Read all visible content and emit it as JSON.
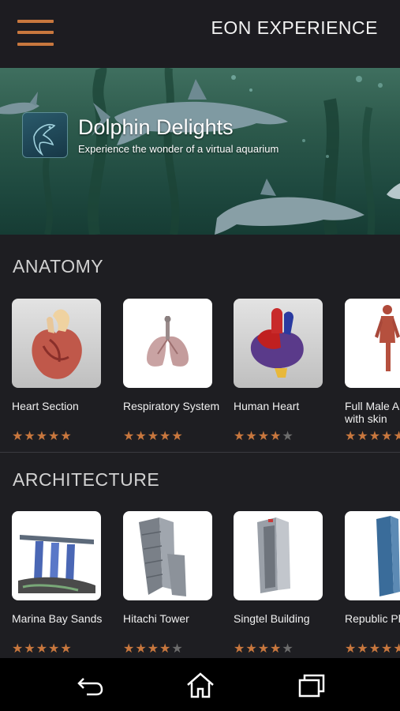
{
  "appbar": {
    "title": "EON EXPERIENCE",
    "menu_icon": "hamburger-menu-icon"
  },
  "banner": {
    "title": "Dolphin Delights",
    "subtitle": "Experience the wonder of a virtual aquarium",
    "thumb_icon": "dolphin-icon"
  },
  "colors": {
    "accent": "#c8773e",
    "background": "#1e1e22",
    "appbar": "#1d1c21",
    "star_off": "#6c6c6c"
  },
  "sections": [
    {
      "title": "ANATOMY",
      "items": [
        {
          "label": "Heart Section",
          "rating": 5,
          "thumb": "heart-section-model"
        },
        {
          "label": "Respiratory System",
          "rating": 5,
          "thumb": "lungs-model"
        },
        {
          "label": "Human Heart",
          "rating": 4,
          "thumb": "human-heart-model"
        },
        {
          "label": "Full Male Anatomy with skin",
          "rating": 5,
          "thumb": "male-anatomy-model"
        }
      ]
    },
    {
      "title": "ARCHITECTURE",
      "items": [
        {
          "label": "Marina Bay Sands",
          "rating": 5,
          "thumb": "marina-bay-sands-model"
        },
        {
          "label": "Hitachi Tower",
          "rating": 4,
          "thumb": "hitachi-tower-model"
        },
        {
          "label": "Singtel Building",
          "rating": 4,
          "thumb": "singtel-building-model"
        },
        {
          "label": "Republic Plaza",
          "rating": 5,
          "thumb": "republic-plaza-model"
        }
      ]
    }
  ],
  "navbar": {
    "back_icon": "back-icon",
    "home_icon": "home-icon",
    "recents_icon": "recent-apps-icon"
  }
}
